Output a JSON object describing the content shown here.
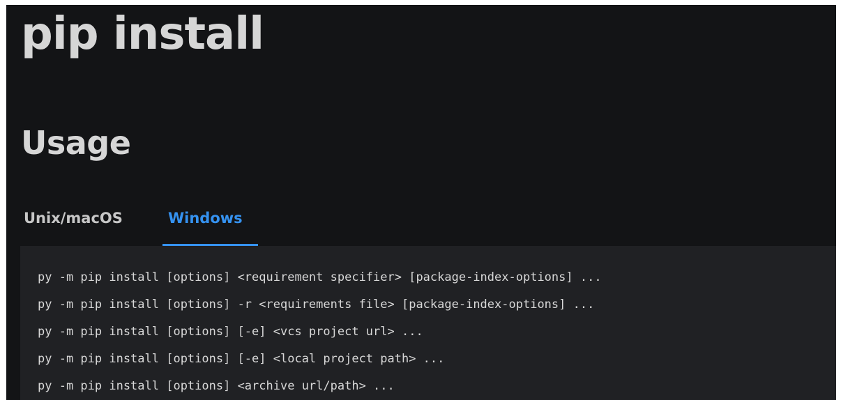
{
  "page": {
    "title": "pip install",
    "section_title": "Usage"
  },
  "tabs": [
    {
      "label": "Unix/macOS",
      "active": false
    },
    {
      "label": "Windows",
      "active": true
    }
  ],
  "code": {
    "lines": [
      "py -m pip install [options] <requirement specifier> [package-index-options] ...",
      "py -m pip install [options] -r <requirements file> [package-index-options] ...",
      "py -m pip install [options] [-e] <vcs project url> ...",
      "py -m pip install [options] [-e] <local project path> ...",
      "py -m pip install [options] <archive url/path> ..."
    ]
  },
  "colors": {
    "background": "#131416",
    "code_background": "#202124",
    "heading_text": "#d6d6d6",
    "active_tab": "#3592f0",
    "inactive_tab": "#c7c7c7"
  }
}
